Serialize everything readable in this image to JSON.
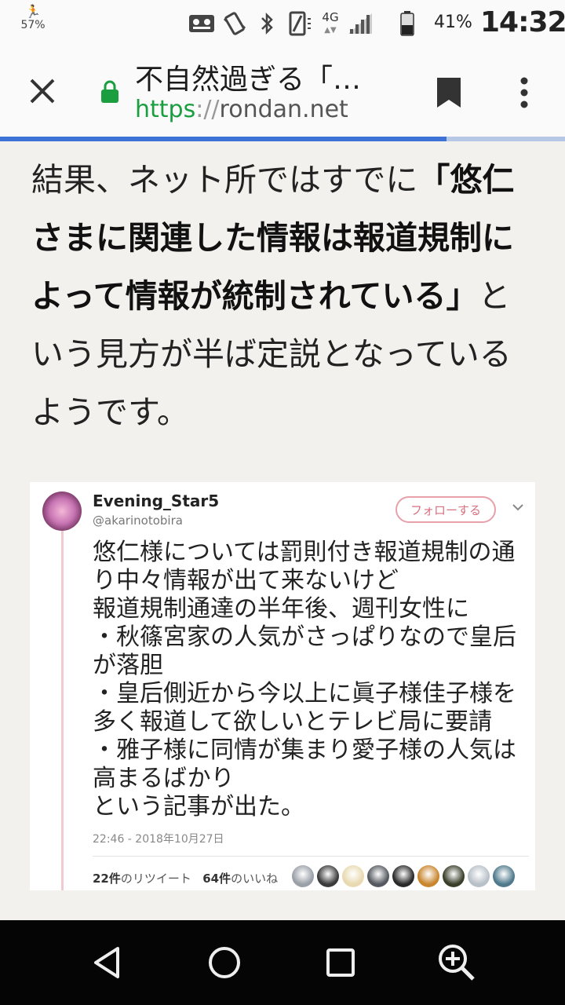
{
  "status_bar": {
    "left_percent": "57%",
    "network": "4G",
    "battery_percent": "41%",
    "clock": "14:32"
  },
  "toolbar": {
    "title": "不自然過ぎる「…",
    "url_scheme": "https",
    "url_sep": "://",
    "url_host": "rondan.net",
    "page_load_progress": 0.79
  },
  "article": {
    "text_plain_1": "結果、ネット所ではすでに",
    "text_bold": "「悠仁さまに関連した情報は報道規制によって情報が統制されている」",
    "text_plain_2": "という見方が半ば定説となっているようです。"
  },
  "tweet": {
    "name": "Evening_Star5",
    "handle": "@akarinotobira",
    "follow_label": "フォローする",
    "lines": [
      "悠仁様については罰則付き報道規制の通",
      "り中々情報が出て来ないけど",
      "報道規制通達の半年後、週刊女性に",
      "・秋篠宮家の人気がさっぱりなので皇后",
      "が落胆",
      "・皇后側近から今以上に眞子様佳子様を",
      "多く報道して欲しいとテレビ局に要請",
      "・雅子様に同情が集まり愛子様の人気は",
      "高まるばかり",
      "という記事が出た。"
    ],
    "timestamp": "22:46 - 2018年10月27日",
    "retweets_count": "22件",
    "retweets_label": "のリツイート",
    "likes_count": "64件",
    "likes_label": "のいいね",
    "liker_colors": [
      "#9aa0a8",
      "#3b3b3b",
      "#e8d9b0",
      "#555a60",
      "#2a2a2a",
      "#c9862e",
      "#3a3f2a",
      "#b8c0c8",
      "#4f7a8c"
    ]
  },
  "nav_bar": {
    "icons": [
      "back-icon",
      "home-icon",
      "recents-icon",
      "zoom-icon"
    ]
  },
  "colors": {
    "accent_green": "#1a9e3f",
    "progress_blue": "#3d73d6",
    "follow_pink": "#d9707f"
  }
}
